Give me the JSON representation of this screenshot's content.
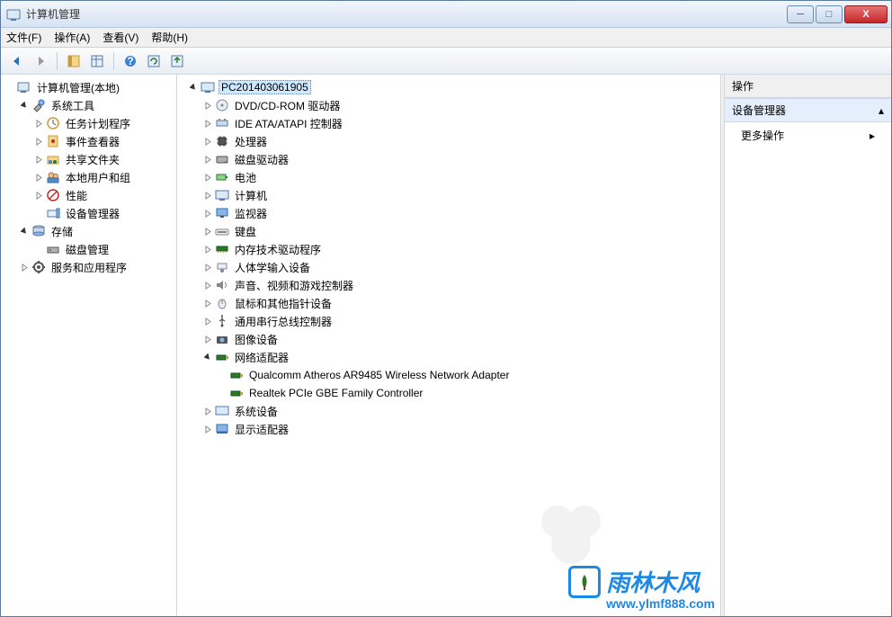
{
  "titlebar": {
    "title": "计算机管理"
  },
  "menu": {
    "file": "文件(F)",
    "action": "操作(A)",
    "view": "查看(V)",
    "help": "帮助(H)"
  },
  "left_tree": {
    "root": "计算机管理(本地)",
    "system_tools": "系统工具",
    "task_scheduler": "任务计划程序",
    "event_viewer": "事件查看器",
    "shared_folders": "共享文件夹",
    "local_users": "本地用户和组",
    "performance": "性能",
    "device_manager": "设备管理器",
    "storage": "存储",
    "disk_management": "磁盘管理",
    "services_apps": "服务和应用程序"
  },
  "center_tree": {
    "computer": "PC201403061905",
    "dvd": "DVD/CD-ROM 驱动器",
    "ide": "IDE ATA/ATAPI 控制器",
    "cpu": "处理器",
    "disk_drives": "磁盘驱动器",
    "battery": "电池",
    "computers": "计算机",
    "monitors": "监视器",
    "keyboards": "键盘",
    "memory_tech": "内存技术驱动程序",
    "hid": "人体学输入设备",
    "sound": "声音、视频和游戏控制器",
    "mouse": "鼠标和其他指针设备",
    "usb": "通用串行总线控制器",
    "imaging": "图像设备",
    "network_adapters": "网络适配器",
    "net1": "Qualcomm Atheros AR9485 Wireless Network Adapter",
    "net2": "Realtek PCIe GBE Family Controller",
    "system_devices": "系统设备",
    "display_adapters": "显示适配器"
  },
  "actions": {
    "header": "操作",
    "title": "设备管理器",
    "more": "更多操作"
  },
  "watermark": {
    "name": "雨林木风",
    "url": "www.ylmf888.com"
  }
}
